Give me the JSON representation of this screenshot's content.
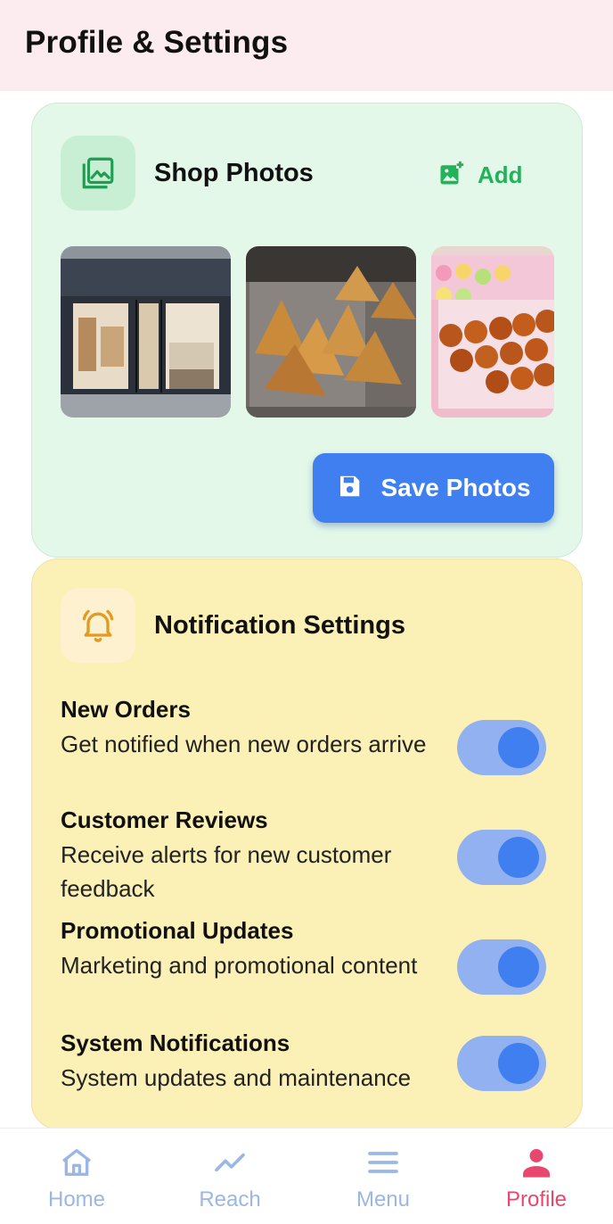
{
  "header": {
    "title": "Profile & Settings"
  },
  "shop_photos": {
    "title": "Shop Photos",
    "add_label": "Add",
    "save_label": "Save Photos",
    "photos": [
      {
        "icon": "storefront-photo"
      },
      {
        "icon": "samosa-photo"
      },
      {
        "icon": "sweets-photo"
      }
    ]
  },
  "notifications": {
    "title": "Notification Settings",
    "items": [
      {
        "title": "New Orders",
        "description": "Get notified when new orders arrive",
        "enabled": true
      },
      {
        "title": "Customer Reviews",
        "description": "Receive alerts for new customer feedback",
        "enabled": true
      },
      {
        "title": "Promotional Updates",
        "description": "Marketing and promotional content",
        "enabled": true
      },
      {
        "title": "System Notifications",
        "description": "System updates and maintenance",
        "enabled": true
      }
    ]
  },
  "nav": {
    "items": [
      {
        "label": "Home",
        "icon": "home-icon"
      },
      {
        "label": "Reach",
        "icon": "trend-icon"
      },
      {
        "label": "Menu",
        "icon": "menu-icon"
      },
      {
        "label": "Profile",
        "icon": "person-icon",
        "active": true
      }
    ]
  },
  "colors": {
    "accent": "#3f7ff0",
    "green": "#22b35a",
    "active_nav": "#e8476e",
    "inactive_nav": "#9bb7e4"
  }
}
